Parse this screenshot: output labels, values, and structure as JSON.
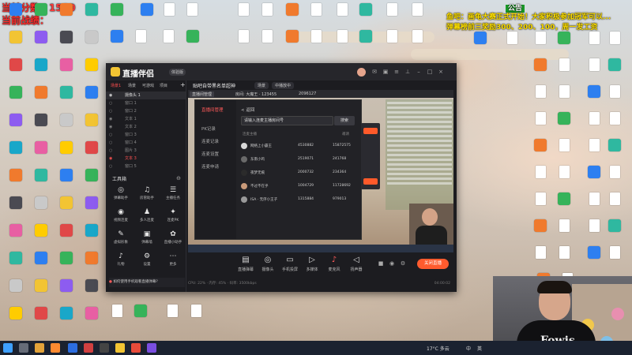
{
  "overlay_left": {
    "score_label": "当前分数：",
    "score_value": "1500",
    "record_label": "当前战绩："
  },
  "overlay_right": {
    "announce_tag": "公告",
    "line1": "鱼吧：画龟大赛正式开始！大家积极参加冠军可以...",
    "line2": "弹幕榜前三奖励300、200、100，周一发工资"
  },
  "desktop_icons": {
    "col0": [
      "",
      "Microsoft Edge",
      "",
      "",
      "",
      "",
      "",
      "",
      "",
      "",
      "",
      ""
    ],
    "col1": [
      "",
      "",
      "",
      "",
      "",
      "",
      "",
      "",
      "",
      "",
      "",
      ""
    ],
    "col2": [
      "",
      "",
      "",
      "",
      "",
      "",
      "",
      "",
      "",
      "",
      "",
      ""
    ]
  },
  "app": {
    "title": "直播伴侣",
    "version_badge": "体验版",
    "tabs": [
      "场景1",
      "场景",
      "可游戏",
      "项目"
    ],
    "scene_title": "贴吧自带黑名单超神",
    "scene_pills": [
      "场景",
      "中播放中"
    ],
    "layers": [
      {
        "label": "摄像头 1",
        "visible": true
      },
      {
        "label": "窗口 1",
        "visible": false
      },
      {
        "label": "窗口 2",
        "visible": false
      },
      {
        "label": "文本 1",
        "visible": true
      },
      {
        "label": "文本 2",
        "visible": true
      },
      {
        "label": "窗口 3",
        "visible": false
      },
      {
        "label": "窗口 4",
        "visible": false
      },
      {
        "label": "图片 3",
        "visible": false
      },
      {
        "label": "文本 3",
        "visible": true,
        "red": true
      },
      {
        "label": "窗口 5",
        "visible": false
      }
    ],
    "tools_header": "工具箱",
    "tools": [
      {
        "icon": "◎",
        "label": "弹幕助手"
      },
      {
        "icon": "♫",
        "label": "房管助手"
      },
      {
        "icon": "☰",
        "label": "主播任务"
      },
      {
        "icon": "◉",
        "label": "视频连麦"
      },
      {
        "icon": "♟",
        "label": "多人连麦"
      },
      {
        "icon": "✦",
        "label": "连麦PK"
      },
      {
        "icon": "✎",
        "label": "虚拟形象"
      },
      {
        "icon": "▣",
        "label": "弹幕墙"
      },
      {
        "icon": "✿",
        "label": "直播小助手"
      },
      {
        "icon": "♪",
        "label": "礼物"
      },
      {
        "icon": "⚙",
        "label": "设置"
      },
      {
        "icon": "⋯",
        "label": "更多"
      }
    ],
    "notice": "如何使用手机观看直播弹幕?",
    "preview_header": {
      "room_tab": "直播间管理",
      "stat1": "房间: 大魔王 · 123455",
      "stat2": "2096127"
    },
    "panel": {
      "side_items": [
        "直播间管理",
        "PK记录",
        "连麦记录",
        "连麦设置",
        "连麦申请"
      ],
      "back": "< 返回",
      "search_value": "请输入连麦主播房间号",
      "search_btn": "搜索",
      "list_header_left": "连麦主播",
      "list_header_right": "邀请",
      "rows": [
        {
          "name": "网络上小霸王",
          "a": "4530882",
          "b": "15872575"
        },
        {
          "name": "东南小鸡",
          "a": "2519071",
          "b": "241768"
        },
        {
          "name": "夜梦无痕",
          "a": "2000732",
          "b": "234364"
        },
        {
          "name": "不过不在乎",
          "a": "1004729",
          "b": "11728692"
        },
        {
          "name": "ISA · 无序小王子",
          "a": "1315884",
          "b": "979013"
        }
      ]
    },
    "controls": [
      {
        "icon": "▤",
        "label": "直播弹幕"
      },
      {
        "icon": "◎",
        "label": "摄像头"
      },
      {
        "icon": "▭",
        "label": "手机投屏"
      },
      {
        "icon": "▷",
        "label": "多媒体"
      },
      {
        "icon": "♪",
        "label": "麦克风"
      },
      {
        "icon": "◁",
        "label": "扬声器"
      }
    ],
    "go_live_label": "关闭直播",
    "time": "04:00:02",
    "status_left": "CPU: 22% · 内存: 45% · 码率: 3500kbps"
  },
  "cam": {
    "shirt_text": "Fowis"
  },
  "taskbar": {
    "weather": "17°C 多云",
    "ime": "中",
    "lang": "英"
  }
}
